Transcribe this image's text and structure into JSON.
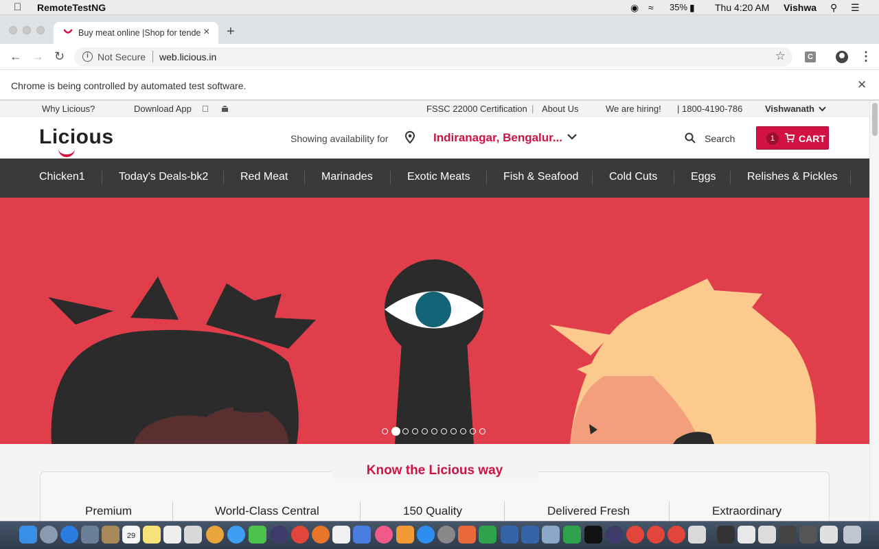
{
  "menubar": {
    "app_name": "RemoteTestNG",
    "battery": "35%",
    "time": "Thu 4:20 AM",
    "user": "Vishwa"
  },
  "browser": {
    "tab_title": "Buy meat online |Shop for tender",
    "security_label": "Not Secure",
    "url": "web.licious.in",
    "ext_label": "C",
    "infobar_message": "Chrome is being controlled by automated test software."
  },
  "topstrip": {
    "why": "Why Licious?",
    "download": "Download App",
    "fssc": "FSSC 22000 Certification",
    "about": "About Us",
    "hiring": "We are hiring!",
    "phone": "| 1800-4190-786",
    "user": "Vishwanath"
  },
  "header": {
    "logo": "Licious",
    "availability_label": "Showing availability for",
    "location": "Indiranagar, Bengalur...",
    "search_label": "Search",
    "cart_count": "1",
    "cart_label": "CART"
  },
  "categories": [
    "Chicken1",
    "Today's Deals-bk2",
    "Red Meat",
    "Marinades",
    "Exotic Meats",
    "Fish & Seafood",
    "Cold Cuts",
    "Eggs",
    "Relishes & Pickles"
  ],
  "hero": {
    "slide_count": 11,
    "active_slide": 2
  },
  "know": {
    "title": "Know the Licious way",
    "features": [
      "Premium",
      "World-Class Central",
      "150 Quality",
      "Delivered Fresh",
      "Extraordinary"
    ]
  },
  "colors": {
    "brand": "#d11243",
    "hero_bg": "#e03e4b",
    "nav_bg": "#3a3a3a"
  },
  "dock": {
    "calendar_day": "29"
  }
}
